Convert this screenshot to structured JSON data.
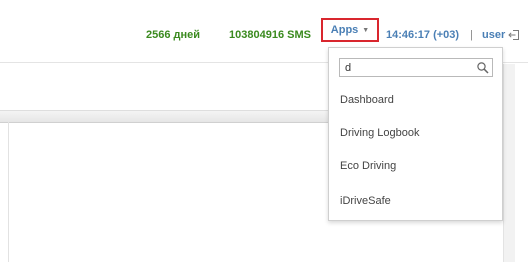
{
  "header": {
    "days_counter": "2566 дней",
    "sms_counter": "103804916 SMS",
    "apps_label": "Apps",
    "clock": "14:46:17 (+03)",
    "separator": "|",
    "user_label": "user"
  },
  "apps_dropdown": {
    "search_value": "d",
    "search_placeholder": "",
    "items": [
      {
        "label": "Dashboard"
      },
      {
        "label": "Driving Logbook"
      },
      {
        "label": "Eco Driving"
      },
      {
        "label": "iDriveSafe"
      }
    ]
  },
  "colors": {
    "counter_green": "#3a8a1e",
    "link_blue": "#4a7fb5",
    "highlight_red": "#d9262e"
  },
  "icons": [
    "chevron-down-icon",
    "logout-icon",
    "search-icon"
  ]
}
